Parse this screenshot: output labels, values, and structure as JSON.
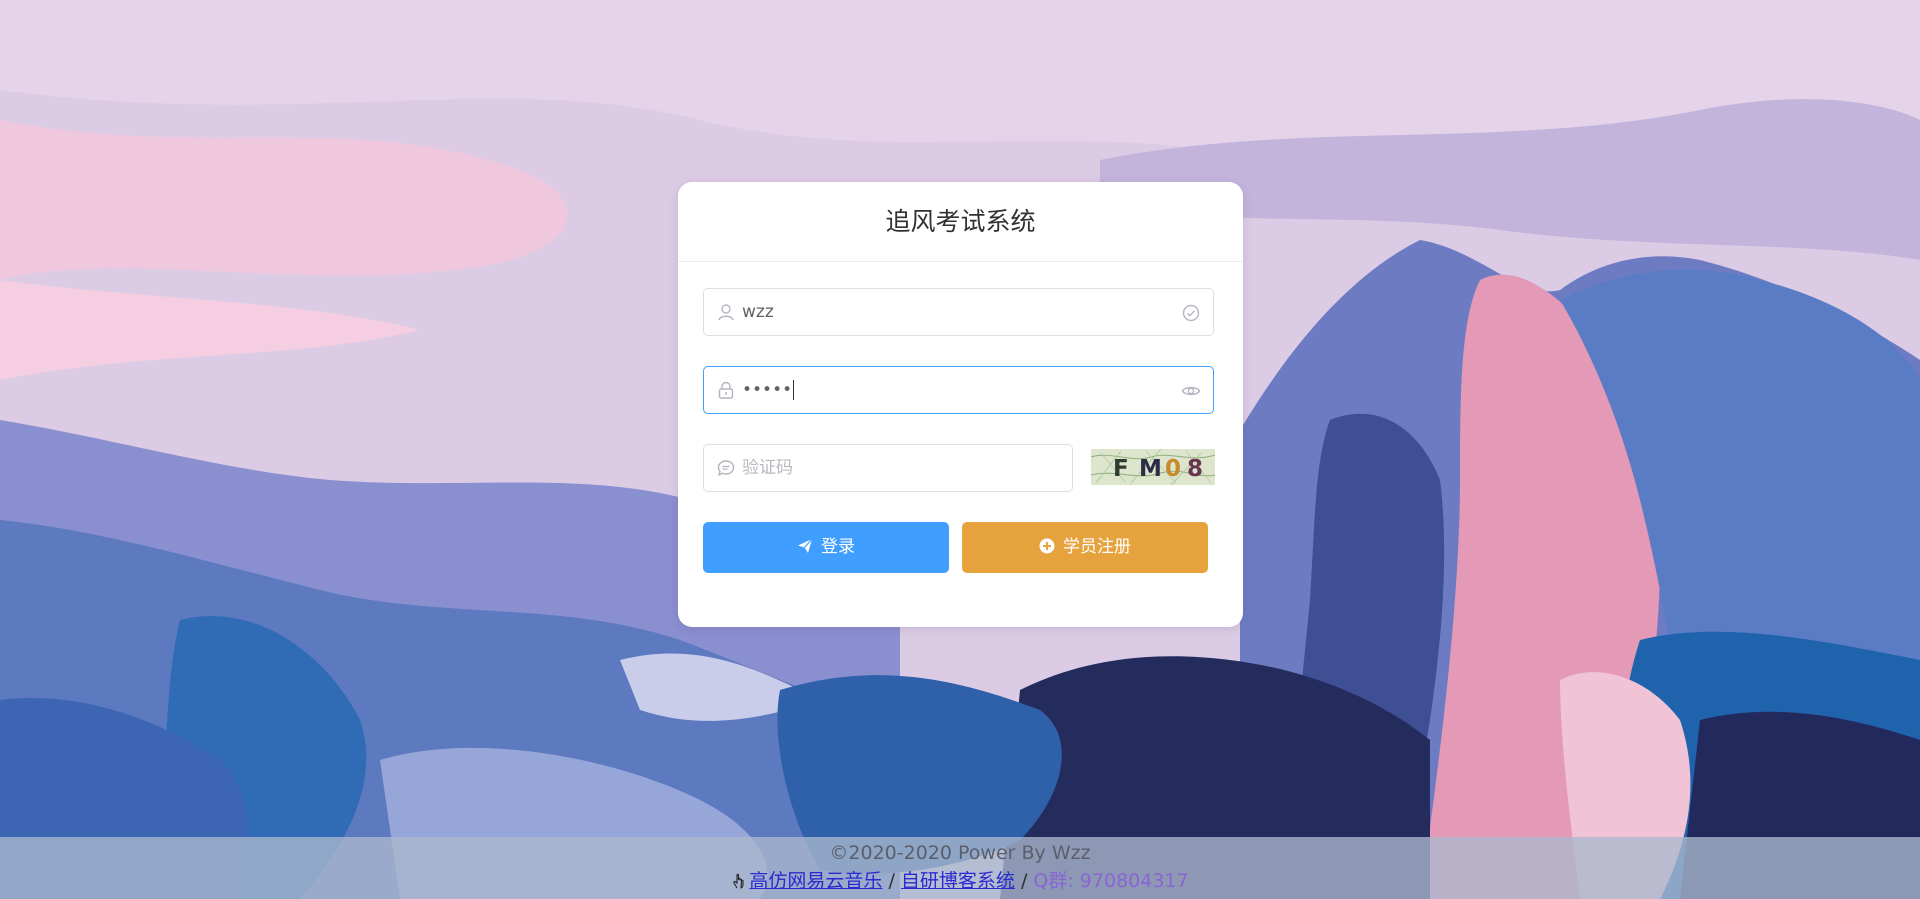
{
  "title": "追风考试系统",
  "username": {
    "value": "wzz"
  },
  "password": {
    "value": "•••••"
  },
  "captcha_input": {
    "placeholder": "验证码"
  },
  "captcha_image": {
    "text": [
      "F",
      "M",
      "0",
      "8"
    ]
  },
  "buttons": {
    "login": "登录",
    "register": "学员注册"
  },
  "footer": {
    "copyright": "©2020-2020 Power By Wzz",
    "link1": "高仿网易云音乐",
    "sep": "/",
    "link2": "自研博客系统",
    "qq": "Q群: 970804317"
  },
  "colors": {
    "primary": "#409eff",
    "warning": "#e6a23c",
    "focus_border": "#409eff"
  }
}
